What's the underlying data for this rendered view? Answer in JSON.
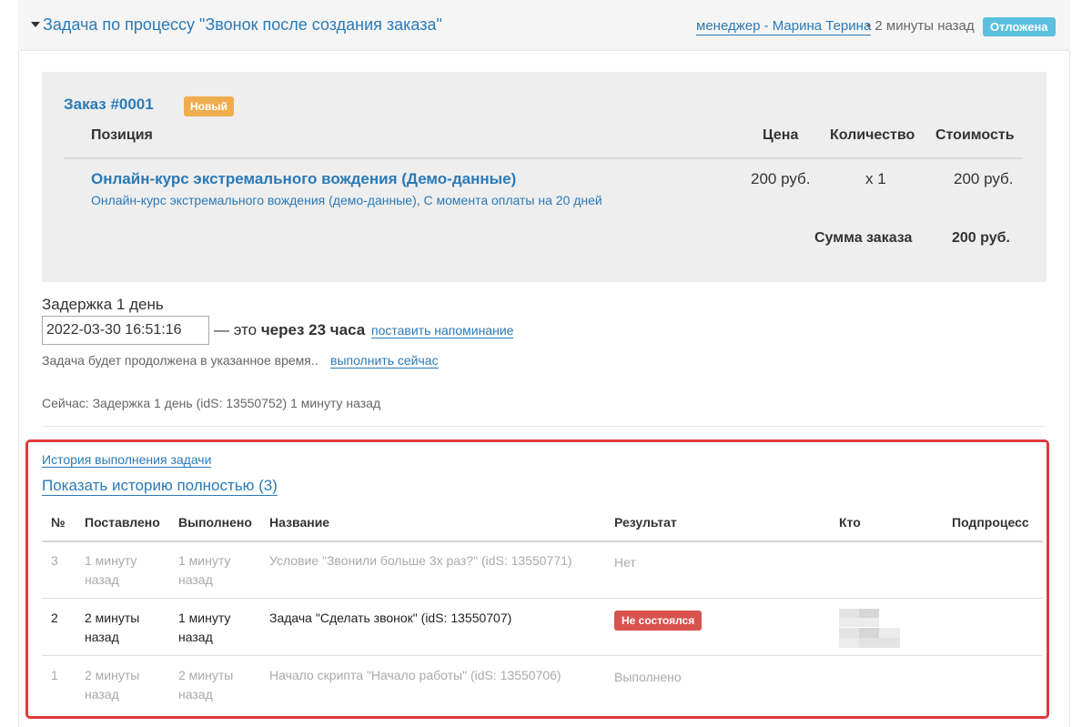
{
  "task_header": {
    "title": "Задача по процессу \"Звонок после создания заказа\"",
    "manager_link": "менеджер - Марина Терина",
    "time_ago": "• 2 минуты назад",
    "status_badge": "Отложена",
    "status_color": "#5bc0de"
  },
  "order": {
    "title": "Заказ #0001",
    "status_badge": "Новый",
    "status_color": "#f0ad4e",
    "columns": [
      "Позиция",
      "Цена",
      "Количество",
      "Стоимость"
    ],
    "items": [
      {
        "name": "Онлайн-курс экстремального вождения (Демо-данные)",
        "description": "Онлайн-курс экстремального вождения (демо-данные), С момента оплаты на 20 дней",
        "price": "200 руб.",
        "quantity": "x 1",
        "cost": "200 руб."
      }
    ],
    "total_label": "Сумма заказа",
    "total_value": "200 руб."
  },
  "delay": {
    "label": "Задержка 1 день",
    "datetime_value": "2022-03-30 16:51:16",
    "relative_prefix": "— это",
    "relative_bold": "через 23 часа",
    "reminder_link": "поставить напоминание",
    "continue_text": "Задача будет продолжена в указанное время..",
    "run_now_link": "выполнить сейчас",
    "now_text": "Сейчас: Задержка 1 день (idS: 13550752) 1 минуту назад"
  },
  "history": {
    "link": "История выполнения задачи",
    "show_full_link": "Показать историю полностью (3)",
    "columns": [
      "№",
      "Поставлено",
      "Выполнено",
      "Название",
      "Результат",
      "Кто",
      "Подпроцесс"
    ],
    "rows": [
      {
        "num": "3",
        "placed_1": "1 минуту",
        "placed_2": "назад",
        "done_1": "1 минуту",
        "done_2": "назад",
        "name": "Условие \"Звонили больше 3х раз?\" (idS: 13550771)",
        "result": "Нет"
      },
      {
        "num": "2",
        "placed_1": "2 минуты",
        "placed_2": "назад",
        "done_1": "1 минуту",
        "done_2": "назад",
        "name": "Задача \"Сделать звонок\" (idS: 13550707)",
        "result": "Не состоялся",
        "result_color": "#d9534f"
      },
      {
        "num": "1",
        "placed_1": "2 минуты",
        "placed_2": "назад",
        "done_1": "2 минуты",
        "done_2": "назад",
        "name": "Начало скрипта \"Начало работы\" (idS: 13550706)",
        "result": "Выполнено"
      }
    ]
  }
}
